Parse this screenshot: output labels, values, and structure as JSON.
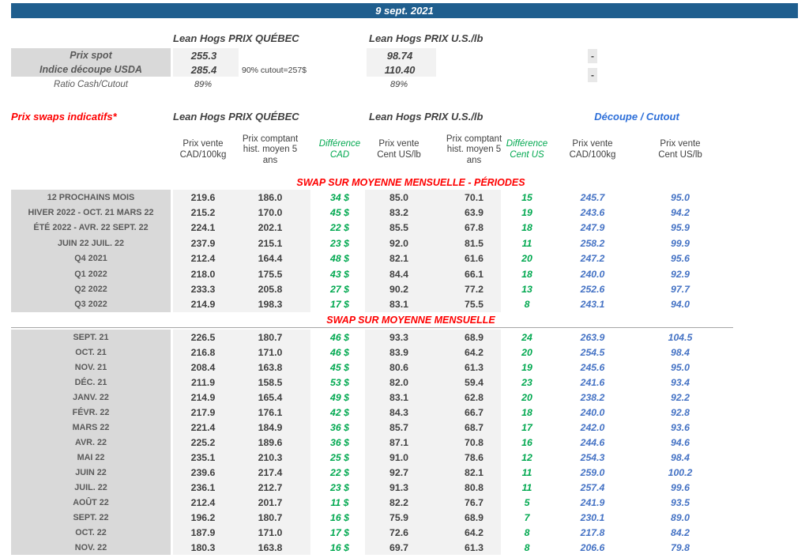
{
  "date_banner": "9 sept. 2021",
  "colors": {
    "banner_bg": "#1F5E8E",
    "red": "#FE0000",
    "green": "#00A84F",
    "blue_values": "#4472C4",
    "blue_header": "#2D6FD9",
    "label_band": "#D9D9D9",
    "value_band": "#F2F2F2"
  },
  "top": {
    "qc_header": "Lean Hogs PRIX QUÉBEC",
    "us_header": "Lean Hogs PRIX U.S./lb",
    "rows": [
      {
        "label": "Prix spot",
        "qc": "255.3",
        "note": "",
        "us": "98.74",
        "dash": "-"
      },
      {
        "label": "Indice découpe USDA",
        "qc": "285.4",
        "note": "90% cutout=257$",
        "us": "110.40",
        "dash": "-"
      }
    ],
    "ratio": {
      "label": "Ratio Cash/Cutout",
      "qc": "89%",
      "us": "89%"
    }
  },
  "swaps": {
    "title": "Prix swaps indicatifs*",
    "qc_header": "Lean Hogs PRIX QUÉBEC",
    "us_header": "Lean Hogs PRIX U.S./lb",
    "cutout_header": "Découpe / Cutout",
    "col_headers": [
      "Prix vente\nCAD/100kg",
      "Prix comptant\nhist. moyen 5\nans",
      "Différence\nCAD",
      "Prix vente\nCent US/lb",
      "Prix comptant\nhist. moyen 5\nans",
      "Différence\nCent US",
      "Prix vente\nCAD/100kg",
      "Prix vente\nCent US/lb"
    ],
    "col_keys": [
      "prix-vente-cad",
      "prix-comptant-cad",
      "difference-cad",
      "prix-vente-us",
      "prix-comptant-us",
      "difference-us",
      "cutout-vente-cad",
      "cutout-vente-us"
    ],
    "sections": [
      {
        "title": "SWAP SUR MOYENNE MENSUELLE - PÉRIODES",
        "rows": [
          {
            "label": "12 PROCHAINS MOIS",
            "cells": [
              "219.6",
              "186.0",
              "34 $",
              "85.0",
              "70.1",
              "15",
              "245.7",
              "95.0"
            ]
          },
          {
            "label": "HIVER 2022 - OCT. 21 MARS 22",
            "cells": [
              "215.2",
              "170.0",
              "45 $",
              "83.2",
              "63.9",
              "19",
              "243.6",
              "94.2"
            ]
          },
          {
            "label": "ÉTÉ 2022 - AVR. 22 SEPT. 22",
            "cells": [
              "224.1",
              "202.1",
              "22 $",
              "85.5",
              "67.8",
              "18",
              "247.9",
              "95.9"
            ]
          },
          {
            "label": "JUIN 22 JUIL. 22",
            "cells": [
              "237.9",
              "215.1",
              "23 $",
              "92.0",
              "81.5",
              "11",
              "258.2",
              "99.9"
            ]
          },
          {
            "label": "Q4 2021",
            "cells": [
              "212.4",
              "164.4",
              "48 $",
              "82.1",
              "61.6",
              "20",
              "247.2",
              "95.6"
            ]
          },
          {
            "label": "Q1 2022",
            "cells": [
              "218.0",
              "175.5",
              "43 $",
              "84.4",
              "66.1",
              "18",
              "240.0",
              "92.9"
            ]
          },
          {
            "label": "Q2 2022",
            "cells": [
              "233.3",
              "205.8",
              "27 $",
              "90.2",
              "77.2",
              "13",
              "252.6",
              "97.7"
            ]
          },
          {
            "label": "Q3 2022",
            "cells": [
              "214.9",
              "198.3",
              "17 $",
              "83.1",
              "75.5",
              "8",
              "243.1",
              "94.0"
            ]
          }
        ]
      },
      {
        "title": "SWAP SUR MOYENNE MENSUELLE",
        "rows": [
          {
            "label": "SEPT. 21",
            "cells": [
              "226.5",
              "180.7",
              "46 $",
              "93.3",
              "68.9",
              "24",
              "263.9",
              "104.5"
            ]
          },
          {
            "label": "OCT. 21",
            "cells": [
              "216.8",
              "171.0",
              "46 $",
              "83.9",
              "64.2",
              "20",
              "254.5",
              "98.4"
            ]
          },
          {
            "label": "NOV. 21",
            "cells": [
              "208.4",
              "163.8",
              "45 $",
              "80.6",
              "61.3",
              "19",
              "245.6",
              "95.0"
            ]
          },
          {
            "label": "DÉC. 21",
            "cells": [
              "211.9",
              "158.5",
              "53 $",
              "82.0",
              "59.4",
              "23",
              "241.6",
              "93.4"
            ]
          },
          {
            "label": "JANV. 22",
            "cells": [
              "214.9",
              "165.4",
              "49 $",
              "83.1",
              "62.8",
              "20",
              "238.2",
              "92.2"
            ]
          },
          {
            "label": "FÉVR. 22",
            "cells": [
              "217.9",
              "176.1",
              "42 $",
              "84.3",
              "66.7",
              "18",
              "240.0",
              "92.8"
            ]
          },
          {
            "label": "MARS 22",
            "cells": [
              "221.4",
              "184.9",
              "36 $",
              "85.7",
              "68.7",
              "17",
              "242.0",
              "93.6"
            ]
          },
          {
            "label": "AVR. 22",
            "cells": [
              "225.2",
              "189.6",
              "36 $",
              "87.1",
              "70.8",
              "16",
              "244.6",
              "94.6"
            ]
          },
          {
            "label": "MAI 22",
            "cells": [
              "235.1",
              "210.3",
              "25 $",
              "91.0",
              "78.6",
              "12",
              "254.3",
              "98.4"
            ]
          },
          {
            "label": "JUIN 22",
            "cells": [
              "239.6",
              "217.4",
              "22 $",
              "92.7",
              "82.1",
              "11",
              "259.0",
              "100.2"
            ]
          },
          {
            "label": "JUIL. 22",
            "cells": [
              "236.1",
              "212.7",
              "23 $",
              "91.3",
              "80.8",
              "11",
              "257.4",
              "99.6"
            ]
          },
          {
            "label": "AOÛT 22",
            "cells": [
              "212.4",
              "201.7",
              "11 $",
              "82.2",
              "76.7",
              "5",
              "241.9",
              "93.5"
            ]
          },
          {
            "label": "SEPT. 22",
            "cells": [
              "196.2",
              "180.7",
              "16 $",
              "75.9",
              "68.9",
              "7",
              "230.1",
              "89.0"
            ]
          },
          {
            "label": "OCT. 22",
            "cells": [
              "187.9",
              "171.0",
              "17 $",
              "72.6",
              "64.2",
              "8",
              "217.8",
              "84.2"
            ]
          },
          {
            "label": "NOV. 22",
            "cells": [
              "180.3",
              "163.8",
              "16 $",
              "69.7",
              "61.3",
              "8",
              "206.6",
              "79.8"
            ]
          }
        ]
      }
    ]
  }
}
